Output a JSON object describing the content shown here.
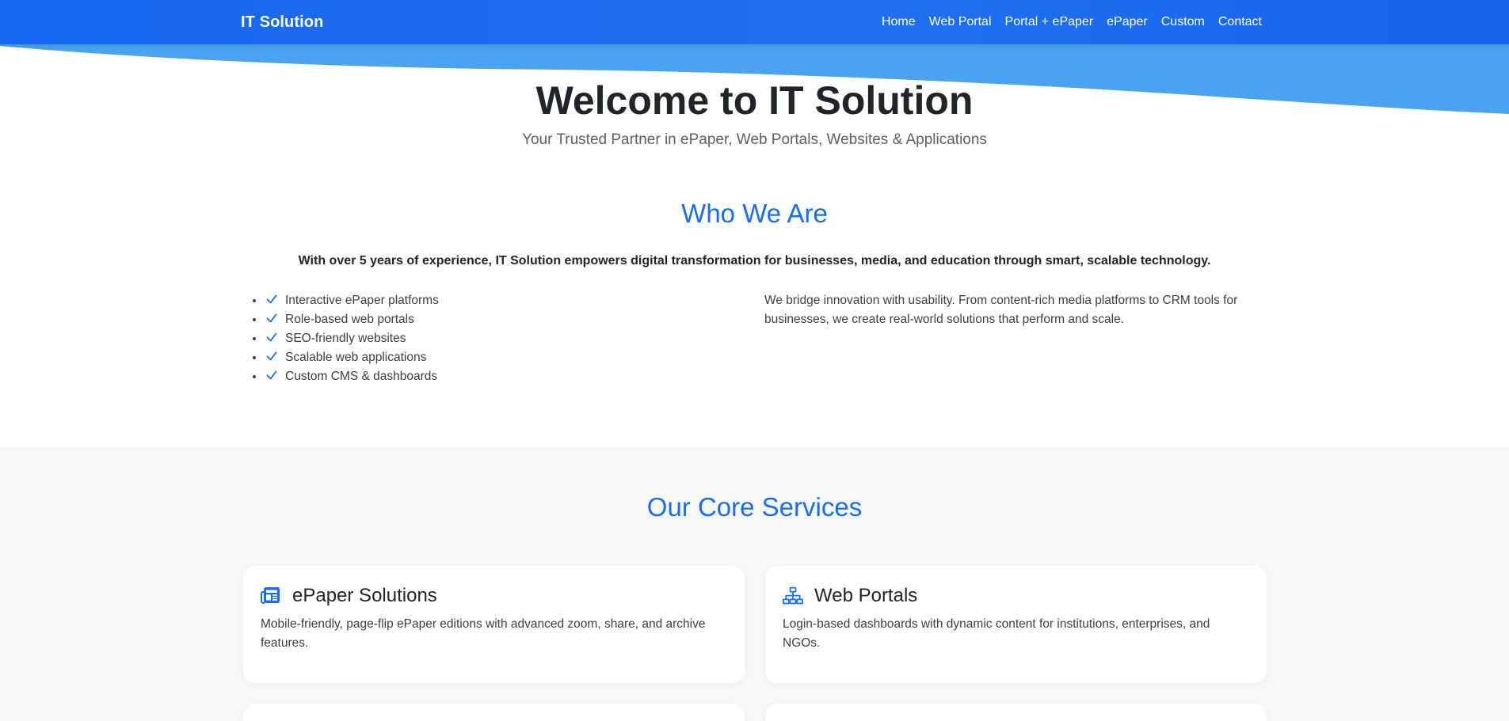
{
  "navbar": {
    "brand": "IT Solution",
    "links": [
      "Home",
      "Web Portal",
      "Portal + ePaper",
      "ePaper",
      "Custom",
      "Contact"
    ]
  },
  "hero": {
    "title": "Welcome to IT Solution",
    "subtitle": "Your Trusted Partner in ePaper, Web Portals, Websites & Applications"
  },
  "about": {
    "title": "Who We Are",
    "lead": "With over 5 years of experience, IT Solution empowers digital transformation for businesses, media, and education through smart, scalable technology.",
    "features": [
      "Interactive ePaper platforms",
      "Role-based web portals",
      "SEO-friendly websites",
      "Scalable web applications",
      "Custom CMS & dashboards"
    ],
    "description": "We bridge innovation with usability. From content-rich media platforms to CRM tools for businesses, we create real-world solutions that perform and scale."
  },
  "services": {
    "title": "Our Core Services",
    "cards": [
      {
        "icon": "newspaper-icon",
        "title": "ePaper Solutions",
        "text": "Mobile-friendly, page-flip ePaper editions with advanced zoom, share, and archive features."
      },
      {
        "icon": "sitemap-icon",
        "title": "Web Portals",
        "text": "Login-based dashboards with dynamic content for institutions, enterprises, and NGOs."
      }
    ]
  },
  "colors": {
    "primary": "#1a6cf0",
    "wave": "#4aa3f0",
    "section_bg": "#f7f8f9"
  }
}
